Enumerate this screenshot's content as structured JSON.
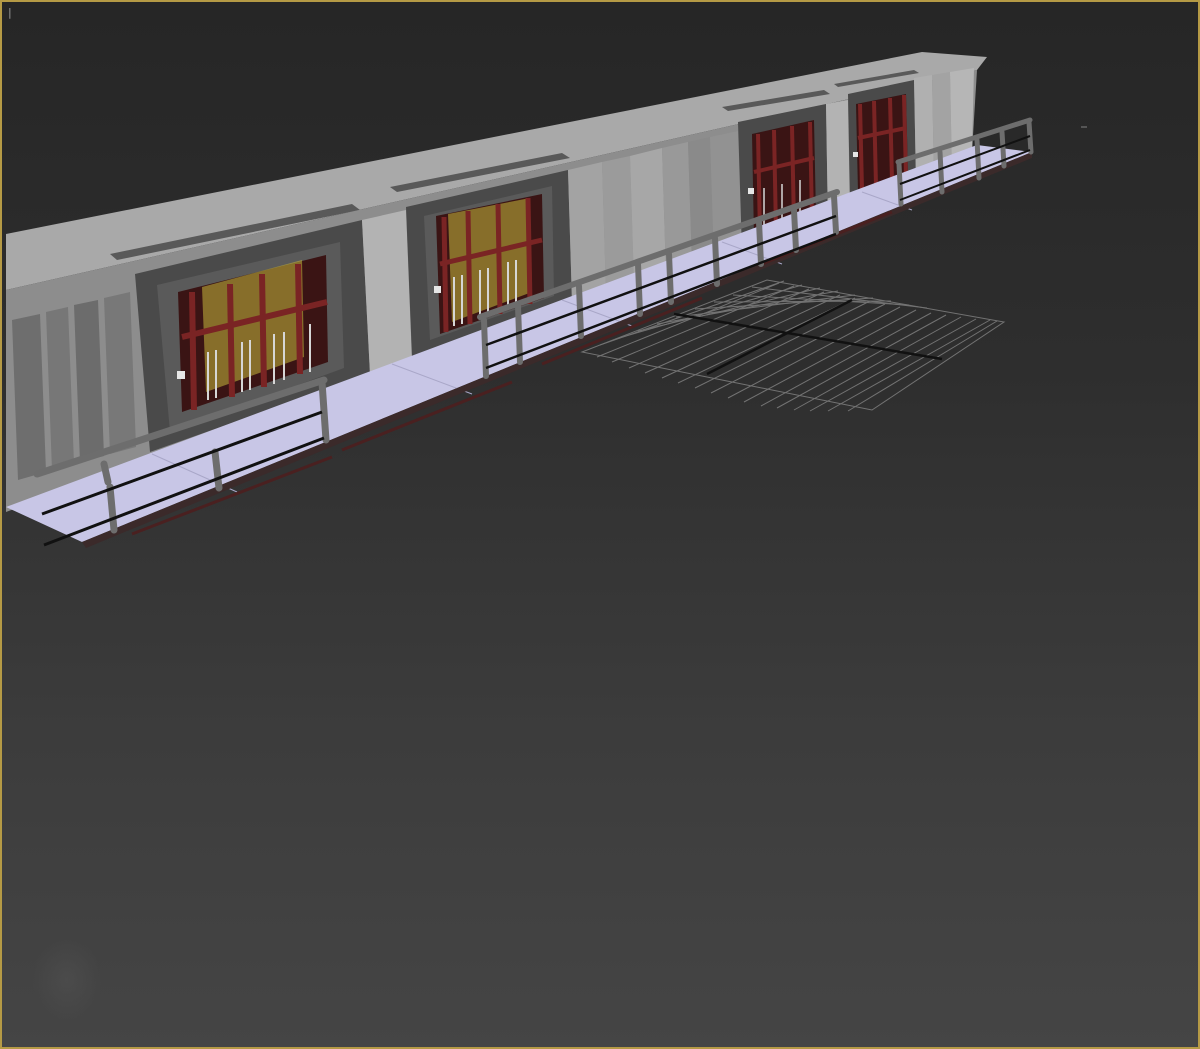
{
  "viewport": {
    "label": "|",
    "border_color": "#b59a45",
    "background_top": "#262626",
    "background_bottom": "#454545"
  },
  "scene": {
    "description_free": true,
    "objects": [
      {
        "kind": "wall",
        "color": "#9a9a9a"
      },
      {
        "kind": "cell-door",
        "color": "#6b1e1e",
        "count": 4
      },
      {
        "kind": "walkway",
        "color": "#c8c6e6"
      },
      {
        "kind": "railing",
        "color": "#6d6d6d"
      },
      {
        "kind": "home-grid",
        "color": "#8c8c8c"
      }
    ]
  }
}
